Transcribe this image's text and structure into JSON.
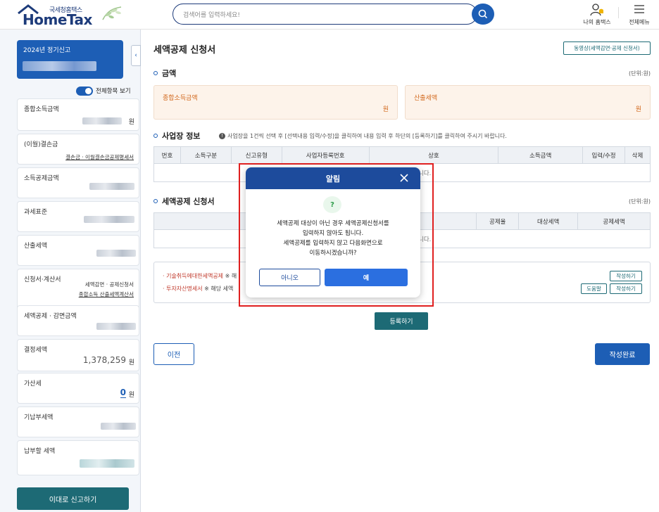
{
  "header": {
    "logo_sub": "국세청홈택스",
    "logo_main": "HomeTax",
    "search_placeholder": "검색어를 입력하세요!",
    "my_hometax": "나의 홈택스",
    "all_menu": "전체메뉴"
  },
  "sidebar": {
    "year_title": "2024년 정기신고",
    "toggle_label": "전체항목 보기",
    "items": [
      {
        "label": "종합소득금액",
        "unit": "원"
      },
      {
        "label": "(이월)결손금",
        "link": "결손금 · 이월결손금공제명세서"
      },
      {
        "label": "소득공제금액"
      },
      {
        "label": "과세표준"
      },
      {
        "label": "산출세액"
      },
      {
        "label": "신청서·계산서",
        "link1": "세액감면 · 공제신청서",
        "link2": "종합소득 산출세액계산서"
      },
      {
        "label": "세액공제 · 감면금액"
      },
      {
        "label": "결정세액",
        "value": "1,378,259",
        "unit": "원"
      },
      {
        "label": "가산세",
        "value": "0",
        "unit": "원"
      },
      {
        "label": "기납부세액"
      },
      {
        "label": "납부할 세액"
      }
    ],
    "report_button": "이대로 신고하기"
  },
  "main": {
    "page_title": "세액공제 신청서",
    "video_button": "동영상(세액감면·공제 신청서)",
    "amount_section": {
      "title": "금액",
      "unit_note": "(단위:원)"
    },
    "amount_boxes": [
      {
        "label": "종합소득금액",
        "unit": "원"
      },
      {
        "label": "산출세액",
        "unit": "원"
      }
    ],
    "biz_section": {
      "title": "사업장 정보",
      "note": "사업장을 1건씩 선택 후 [선택내용 입력/수정]을 클릭하여 내용 입력 후 하단의 [등록하기]를 클릭하여 주시기 바랍니다.",
      "columns": [
        "번호",
        "소득구분",
        "신고유형",
        "사업자등록번호",
        "상호",
        "소득금액",
        "입력/수정",
        "삭제"
      ],
      "empty_tail": "니다."
    },
    "credit_section": {
      "title": "세액공제 신청서",
      "unit_note": "(단위:원)",
      "columns": [
        "공제율",
        "대상세액",
        "공제세액"
      ],
      "empty_tail": "니다."
    },
    "list": [
      {
        "red": "· 기술취득에대한세액공제",
        "gray": "※ 해"
      },
      {
        "red": "· 투자자산명세서",
        "gray": "※ 해당 세액"
      }
    ],
    "write_button": "작성하기",
    "help_button": "도움말",
    "register_button": "등록하기",
    "prev_button": "이전",
    "done_button": "작성완료"
  },
  "modal": {
    "title": "알림",
    "question_mark": "?",
    "message_lines": [
      "세액공제 대상이 아닌 경우 세액공제신청서를",
      "입력하지 않아도 됩니다.",
      "세액공제를 입력하지 않고 다음화면으로",
      "이동하시겠습니까?"
    ],
    "no_button": "아니오",
    "yes_button": "예"
  },
  "icons": {
    "search": "search-icon",
    "my_hometax": "person-bell-icon",
    "menu": "hamburger-icon",
    "close": "close-icon",
    "collapse": "chevron-left-icon",
    "info": "info-icon"
  },
  "colors": {
    "brand_navy": "#1d3b7a",
    "primary_blue": "#1d5eb5",
    "teal": "#1d6a75",
    "highlight_red": "#e02020"
  }
}
